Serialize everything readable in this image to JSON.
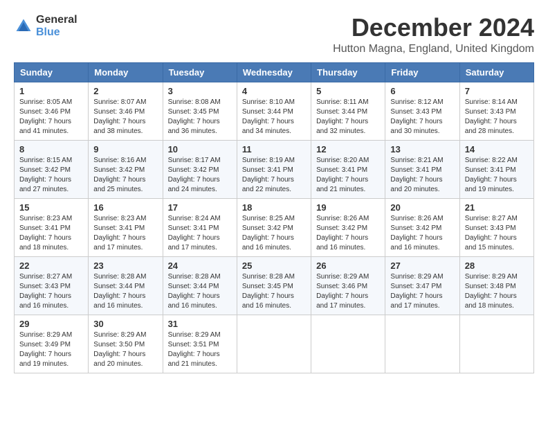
{
  "header": {
    "logo_general": "General",
    "logo_blue": "Blue",
    "title": "December 2024",
    "subtitle": "Hutton Magna, England, United Kingdom"
  },
  "calendar": {
    "days_of_week": [
      "Sunday",
      "Monday",
      "Tuesday",
      "Wednesday",
      "Thursday",
      "Friday",
      "Saturday"
    ],
    "weeks": [
      [
        {
          "day": "1",
          "sunrise": "Sunrise: 8:05 AM",
          "sunset": "Sunset: 3:46 PM",
          "daylight": "Daylight: 7 hours and 41 minutes."
        },
        {
          "day": "2",
          "sunrise": "Sunrise: 8:07 AM",
          "sunset": "Sunset: 3:46 PM",
          "daylight": "Daylight: 7 hours and 38 minutes."
        },
        {
          "day": "3",
          "sunrise": "Sunrise: 8:08 AM",
          "sunset": "Sunset: 3:45 PM",
          "daylight": "Daylight: 7 hours and 36 minutes."
        },
        {
          "day": "4",
          "sunrise": "Sunrise: 8:10 AM",
          "sunset": "Sunset: 3:44 PM",
          "daylight": "Daylight: 7 hours and 34 minutes."
        },
        {
          "day": "5",
          "sunrise": "Sunrise: 8:11 AM",
          "sunset": "Sunset: 3:44 PM",
          "daylight": "Daylight: 7 hours and 32 minutes."
        },
        {
          "day": "6",
          "sunrise": "Sunrise: 8:12 AM",
          "sunset": "Sunset: 3:43 PM",
          "daylight": "Daylight: 7 hours and 30 minutes."
        },
        {
          "day": "7",
          "sunrise": "Sunrise: 8:14 AM",
          "sunset": "Sunset: 3:43 PM",
          "daylight": "Daylight: 7 hours and 28 minutes."
        }
      ],
      [
        {
          "day": "8",
          "sunrise": "Sunrise: 8:15 AM",
          "sunset": "Sunset: 3:42 PM",
          "daylight": "Daylight: 7 hours and 27 minutes."
        },
        {
          "day": "9",
          "sunrise": "Sunrise: 8:16 AM",
          "sunset": "Sunset: 3:42 PM",
          "daylight": "Daylight: 7 hours and 25 minutes."
        },
        {
          "day": "10",
          "sunrise": "Sunrise: 8:17 AM",
          "sunset": "Sunset: 3:42 PM",
          "daylight": "Daylight: 7 hours and 24 minutes."
        },
        {
          "day": "11",
          "sunrise": "Sunrise: 8:19 AM",
          "sunset": "Sunset: 3:41 PM",
          "daylight": "Daylight: 7 hours and 22 minutes."
        },
        {
          "day": "12",
          "sunrise": "Sunrise: 8:20 AM",
          "sunset": "Sunset: 3:41 PM",
          "daylight": "Daylight: 7 hours and 21 minutes."
        },
        {
          "day": "13",
          "sunrise": "Sunrise: 8:21 AM",
          "sunset": "Sunset: 3:41 PM",
          "daylight": "Daylight: 7 hours and 20 minutes."
        },
        {
          "day": "14",
          "sunrise": "Sunrise: 8:22 AM",
          "sunset": "Sunset: 3:41 PM",
          "daylight": "Daylight: 7 hours and 19 minutes."
        }
      ],
      [
        {
          "day": "15",
          "sunrise": "Sunrise: 8:23 AM",
          "sunset": "Sunset: 3:41 PM",
          "daylight": "Daylight: 7 hours and 18 minutes."
        },
        {
          "day": "16",
          "sunrise": "Sunrise: 8:23 AM",
          "sunset": "Sunset: 3:41 PM",
          "daylight": "Daylight: 7 hours and 17 minutes."
        },
        {
          "day": "17",
          "sunrise": "Sunrise: 8:24 AM",
          "sunset": "Sunset: 3:41 PM",
          "daylight": "Daylight: 7 hours and 17 minutes."
        },
        {
          "day": "18",
          "sunrise": "Sunrise: 8:25 AM",
          "sunset": "Sunset: 3:42 PM",
          "daylight": "Daylight: 7 hours and 16 minutes."
        },
        {
          "day": "19",
          "sunrise": "Sunrise: 8:26 AM",
          "sunset": "Sunset: 3:42 PM",
          "daylight": "Daylight: 7 hours and 16 minutes."
        },
        {
          "day": "20",
          "sunrise": "Sunrise: 8:26 AM",
          "sunset": "Sunset: 3:42 PM",
          "daylight": "Daylight: 7 hours and 16 minutes."
        },
        {
          "day": "21",
          "sunrise": "Sunrise: 8:27 AM",
          "sunset": "Sunset: 3:43 PM",
          "daylight": "Daylight: 7 hours and 15 minutes."
        }
      ],
      [
        {
          "day": "22",
          "sunrise": "Sunrise: 8:27 AM",
          "sunset": "Sunset: 3:43 PM",
          "daylight": "Daylight: 7 hours and 16 minutes."
        },
        {
          "day": "23",
          "sunrise": "Sunrise: 8:28 AM",
          "sunset": "Sunset: 3:44 PM",
          "daylight": "Daylight: 7 hours and 16 minutes."
        },
        {
          "day": "24",
          "sunrise": "Sunrise: 8:28 AM",
          "sunset": "Sunset: 3:44 PM",
          "daylight": "Daylight: 7 hours and 16 minutes."
        },
        {
          "day": "25",
          "sunrise": "Sunrise: 8:28 AM",
          "sunset": "Sunset: 3:45 PM",
          "daylight": "Daylight: 7 hours and 16 minutes."
        },
        {
          "day": "26",
          "sunrise": "Sunrise: 8:29 AM",
          "sunset": "Sunset: 3:46 PM",
          "daylight": "Daylight: 7 hours and 17 minutes."
        },
        {
          "day": "27",
          "sunrise": "Sunrise: 8:29 AM",
          "sunset": "Sunset: 3:47 PM",
          "daylight": "Daylight: 7 hours and 17 minutes."
        },
        {
          "day": "28",
          "sunrise": "Sunrise: 8:29 AM",
          "sunset": "Sunset: 3:48 PM",
          "daylight": "Daylight: 7 hours and 18 minutes."
        }
      ],
      [
        {
          "day": "29",
          "sunrise": "Sunrise: 8:29 AM",
          "sunset": "Sunset: 3:49 PM",
          "daylight": "Daylight: 7 hours and 19 minutes."
        },
        {
          "day": "30",
          "sunrise": "Sunrise: 8:29 AM",
          "sunset": "Sunset: 3:50 PM",
          "daylight": "Daylight: 7 hours and 20 minutes."
        },
        {
          "day": "31",
          "sunrise": "Sunrise: 8:29 AM",
          "sunset": "Sunset: 3:51 PM",
          "daylight": "Daylight: 7 hours and 21 minutes."
        },
        null,
        null,
        null,
        null
      ]
    ]
  }
}
